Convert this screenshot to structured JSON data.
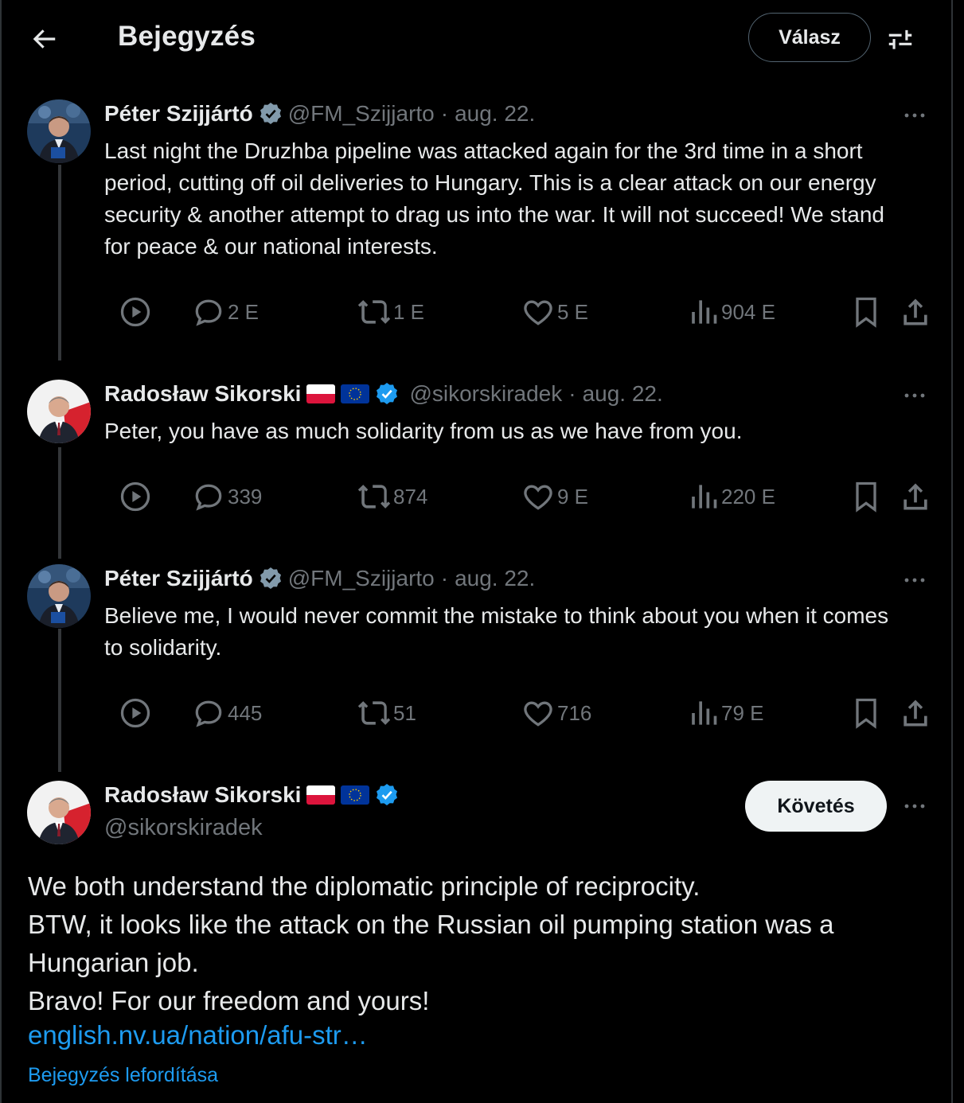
{
  "header": {
    "title": "Bejegyzés",
    "reply_label": "Válasz"
  },
  "tweets": [
    {
      "name": "Péter Szijjártó",
      "handle": "@FM_Szijjarto",
      "sep": "·",
      "date": "aug. 22.",
      "text": "Last night the Druzhba pipeline was attacked again for the 3rd time in a short period, cutting off oil deliveries to Hungary. This is a clear attack on our energy security & another attempt to drag us into the war. It will not succeed! We stand for peace & our national interests.",
      "replies": "2 E",
      "reposts": "1 E",
      "likes": "5 E",
      "views": "904 E"
    },
    {
      "name": "Radosław Sikorski",
      "handle": "@sikorskiradek",
      "sep": "·",
      "date": "aug. 22.",
      "text": "Peter, you have as much solidarity from us as we have from you.",
      "replies": "339",
      "reposts": "874",
      "likes": "9 E",
      "views": "220 E"
    },
    {
      "name": "Péter Szijjártó",
      "handle": "@FM_Szijjarto",
      "sep": "·",
      "date": "aug. 22.",
      "text": "Believe me, I would never commit the mistake to think about you when it comes to solidarity.",
      "replies": "445",
      "reposts": "51",
      "likes": "716",
      "views": "79 E"
    }
  ],
  "main_post": {
    "name": "Radosław Sikorski",
    "handle": "@sikorskiradek",
    "follow_label": "Követés",
    "lines": [
      "We both understand the diplomatic principle of reciprocity.",
      "BTW, it looks like the attack on the Russian oil pumping station was a",
      "Hungarian job.",
      "Bravo! For our freedom and yours!"
    ],
    "link": "english.nv.ua/nation/afu-str…",
    "translate": "Bejegyzés lefordítása"
  },
  "colors": {
    "background": "#000000",
    "text": "#e7e9ea",
    "muted": "#71767b",
    "accent": "#1d9bf0",
    "verified_gray": "#829aab"
  }
}
